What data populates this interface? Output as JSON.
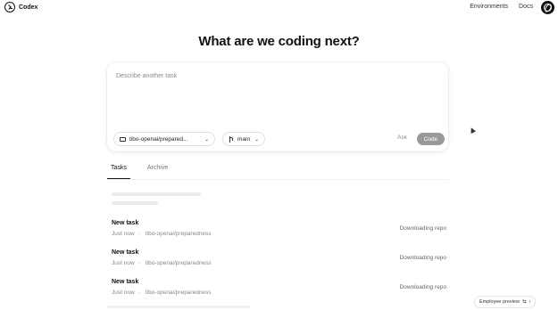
{
  "app": {
    "name": "Codex",
    "logo_icon": "codex-logo-icon"
  },
  "topnav": {
    "environments": "Environments",
    "docs": "Docs",
    "avatar_icon": "openai-knot-icon"
  },
  "heading": "What are we coding next?",
  "composer": {
    "placeholder": "Describe another task",
    "repo": "tibo-openai/prepared...",
    "branch": "main",
    "ask_label": "Ask",
    "code_label": "Code"
  },
  "tabs": [
    {
      "label": "Tasks",
      "active": true
    },
    {
      "label": "Archive",
      "active": false
    }
  ],
  "tasks": [
    {
      "title": "New task",
      "time": "Just now",
      "repo": "tibo-openai/preparedness",
      "status": "Downloading repo"
    },
    {
      "title": "New task",
      "time": "Just now",
      "repo": "tibo-openai/preparedness",
      "status": "Downloading repo"
    },
    {
      "title": "New task",
      "time": "Just now",
      "repo": "tibo-openai/preparedness",
      "status": "Downloading repo"
    }
  ],
  "employee_preview": {
    "label": "Employee preview"
  },
  "colors": {
    "code_button": "#9a9a9a",
    "avatar_bg": "#111111",
    "background": "#ffffff"
  }
}
